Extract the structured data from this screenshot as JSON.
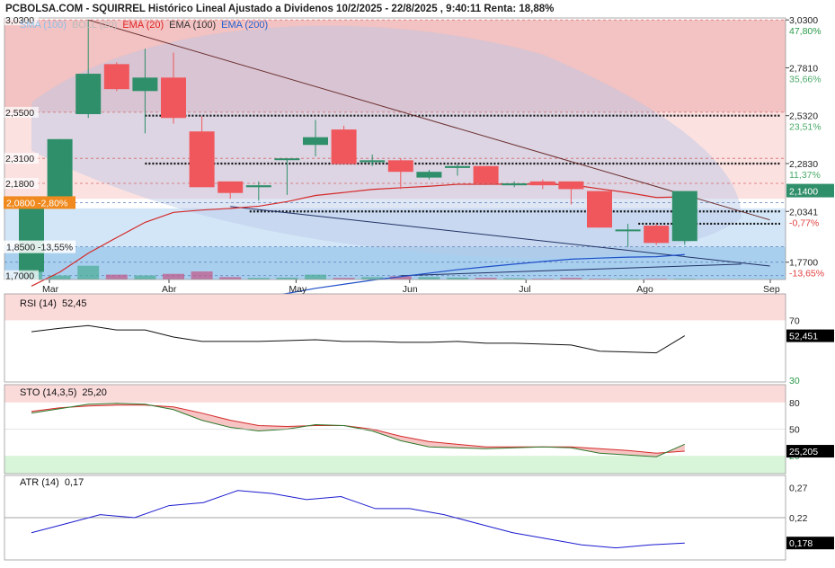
{
  "title": "PCBOLSA.COM - SQUIRREL Histórico Lineal Ajustado a Dividenos 10/2/2025 - 22/8/2025 , 9:40:11 Renta: 18,88%",
  "legend": {
    "sma": "SMA (100)",
    "boll": "BOLL (20)",
    "ema20": "EMA (20)",
    "ema100": "EMA (100)",
    "ema200": "EMA (200)"
  },
  "colors": {
    "up": "#2f8f6a",
    "down": "#f0575c",
    "ema20": "#d42a2a",
    "ema200": "#1f4fc8",
    "rsi_line": "#111111",
    "sto_k": "#2c7a2c",
    "sto_d": "#d42a2a",
    "atr_line": "#1a1ad0"
  },
  "panels": {
    "rsi": {
      "label": "RSI (14)",
      "value": "52,45",
      "ticks": [
        "70",
        "30"
      ],
      "last": "52,451"
    },
    "sto": {
      "label": "STO (14,3,5)",
      "value": "25,20",
      "ticks": [
        "80",
        "50",
        "20"
      ],
      "last": "25,205"
    },
    "atr": {
      "label": "ATR (14)",
      "value": "0,17",
      "ticks": [
        "0,27",
        "0,22",
        "0,18"
      ],
      "last": "0,178"
    }
  },
  "chart_data": [
    {
      "type": "candlestick",
      "title": "PCBOLSA.COM - SQUIRREL Histórico Lineal Ajustado a Dividenos 10/2/2025 - 22/8/2025 , 9:40:11 Renta: 18,88%",
      "x_labels": [
        "Mar",
        "Abr",
        "May",
        "Jun",
        "Jul",
        "Ago",
        "Sep"
      ],
      "ylim": [
        1.68,
        3.04
      ],
      "right_ticks": [
        {
          "value": 3.03,
          "label": "3,0300",
          "pct": "47,80%",
          "pct_color": "#2a9a4a"
        },
        {
          "value": 2.781,
          "label": "2,7810",
          "pct": "35,66%",
          "pct_color": "#4aaa6a"
        },
        {
          "value": 2.532,
          "label": "2,5320",
          "pct": "23,51%",
          "pct_color": "#4aaa6a"
        },
        {
          "value": 2.283,
          "label": "2,2830",
          "pct": "11,37%",
          "pct_color": "#4aaa6a"
        },
        {
          "value": 2.034,
          "label": "2,0341",
          "pct": "-0,77%",
          "pct_color": "#e04040"
        },
        {
          "value": 1.77,
          "label": "1,7700",
          "pct": "-13,65%",
          "pct_color": "#e04040"
        }
      ],
      "left_ticks": [
        {
          "value": 3.03,
          "label": "3,0300"
        },
        {
          "value": 2.55,
          "label": "2,5500"
        },
        {
          "value": 2.31,
          "label": "2,3100"
        },
        {
          "value": 2.18,
          "label": "2,1800"
        },
        {
          "value": 1.7,
          "label": "1,7000"
        }
      ],
      "last_price": {
        "value": 2.14,
        "label": "2,1400"
      },
      "ref_label": {
        "value": 2.08,
        "text": "2,0800 -2,80%"
      },
      "low_label": {
        "value": 1.85,
        "text": "1,8500 -13,55%"
      },
      "dotted_levels": [
        2.532,
        2.283,
        2.034,
        1.97
      ],
      "candles": [
        {
          "o": 1.72,
          "c": 2.08,
          "h": 2.08,
          "l": 1.7
        },
        {
          "o": 2.08,
          "c": 2.41,
          "h": 2.41,
          "l": 2.06
        },
        {
          "o": 2.54,
          "c": 2.75,
          "h": 3.03,
          "l": 2.52
        },
        {
          "o": 2.8,
          "c": 2.67,
          "h": 2.81,
          "l": 2.66
        },
        {
          "o": 2.66,
          "c": 2.73,
          "h": 2.88,
          "l": 2.44
        },
        {
          "o": 2.73,
          "c": 2.52,
          "h": 2.86,
          "l": 2.49
        },
        {
          "o": 2.45,
          "c": 2.16,
          "h": 2.53,
          "l": 2.16
        },
        {
          "o": 2.19,
          "c": 2.13,
          "h": 2.19,
          "l": 2.1
        },
        {
          "o": 2.16,
          "c": 2.17,
          "h": 2.19,
          "l": 2.09
        },
        {
          "o": 2.31,
          "c": 2.31,
          "h": 2.31,
          "l": 2.12
        },
        {
          "o": 2.38,
          "c": 2.42,
          "h": 2.51,
          "l": 2.32
        },
        {
          "o": 2.46,
          "c": 2.28,
          "h": 2.48,
          "l": 2.28
        },
        {
          "o": 2.29,
          "c": 2.3,
          "h": 2.33,
          "l": 2.27
        },
        {
          "o": 2.3,
          "c": 2.24,
          "h": 2.31,
          "l": 2.15
        },
        {
          "o": 2.21,
          "c": 2.24,
          "h": 2.25,
          "l": 2.2
        },
        {
          "o": 2.26,
          "c": 2.27,
          "h": 2.28,
          "l": 2.22
        },
        {
          "o": 2.27,
          "c": 2.18,
          "h": 2.27,
          "l": 2.18
        },
        {
          "o": 2.17,
          "c": 2.18,
          "h": 2.19,
          "l": 2.16
        },
        {
          "o": 2.19,
          "c": 2.17,
          "h": 2.2,
          "l": 2.15
        },
        {
          "o": 2.19,
          "c": 2.15,
          "h": 2.19,
          "l": 2.07
        },
        {
          "o": 2.14,
          "c": 1.95,
          "h": 2.14,
          "l": 1.95
        },
        {
          "o": 1.94,
          "c": 1.94,
          "h": 1.97,
          "l": 1.85
        },
        {
          "o": 1.96,
          "c": 1.87,
          "h": 1.97,
          "l": 1.86
        },
        {
          "o": 1.88,
          "c": 2.14,
          "h": 2.14,
          "l": 1.86
        }
      ],
      "volume": [
        0.55,
        0.25,
        0.85,
        0.3,
        0.25,
        0.35,
        0.5,
        0.15,
        0.1,
        0.12,
        0.3,
        0.1,
        0.15,
        0.2,
        0.15,
        0.12,
        0.1,
        0.08,
        0.05,
        0.1,
        0.05,
        0.05,
        0.05,
        0.05
      ]
    },
    {
      "type": "line",
      "title": "RSI (14)",
      "ylim": [
        0,
        100
      ],
      "y": [
        57,
        61,
        64,
        59,
        59,
        51,
        46,
        46,
        46,
        47,
        48,
        46,
        46,
        45,
        45,
        46,
        44,
        44,
        43,
        42,
        35,
        34,
        33,
        52.45
      ]
    },
    {
      "type": "line",
      "title": "STO (14,3,5)",
      "ylim": [
        0,
        100
      ],
      "series": [
        {
          "values": [
            68,
            73,
            78,
            79,
            78,
            72,
            60,
            52,
            48,
            50,
            55,
            54,
            48,
            37,
            30,
            29,
            28,
            29,
            30,
            29,
            23,
            21,
            19,
            33
          ]
        },
        {
          "values": [
            70,
            74,
            76,
            77,
            77,
            75,
            68,
            60,
            54,
            53,
            54,
            54,
            50,
            42,
            36,
            33,
            30,
            30,
            30,
            30,
            28,
            26,
            23,
            25.2
          ]
        }
      ]
    },
    {
      "type": "line",
      "title": "ATR (14)",
      "ylim": [
        0.15,
        0.29
      ],
      "y": [
        0.195,
        0.21,
        0.225,
        0.22,
        0.24,
        0.245,
        0.265,
        0.26,
        0.25,
        0.255,
        0.235,
        0.235,
        0.225,
        0.21,
        0.195,
        0.185,
        0.175,
        0.17,
        0.175,
        0.178
      ]
    }
  ]
}
